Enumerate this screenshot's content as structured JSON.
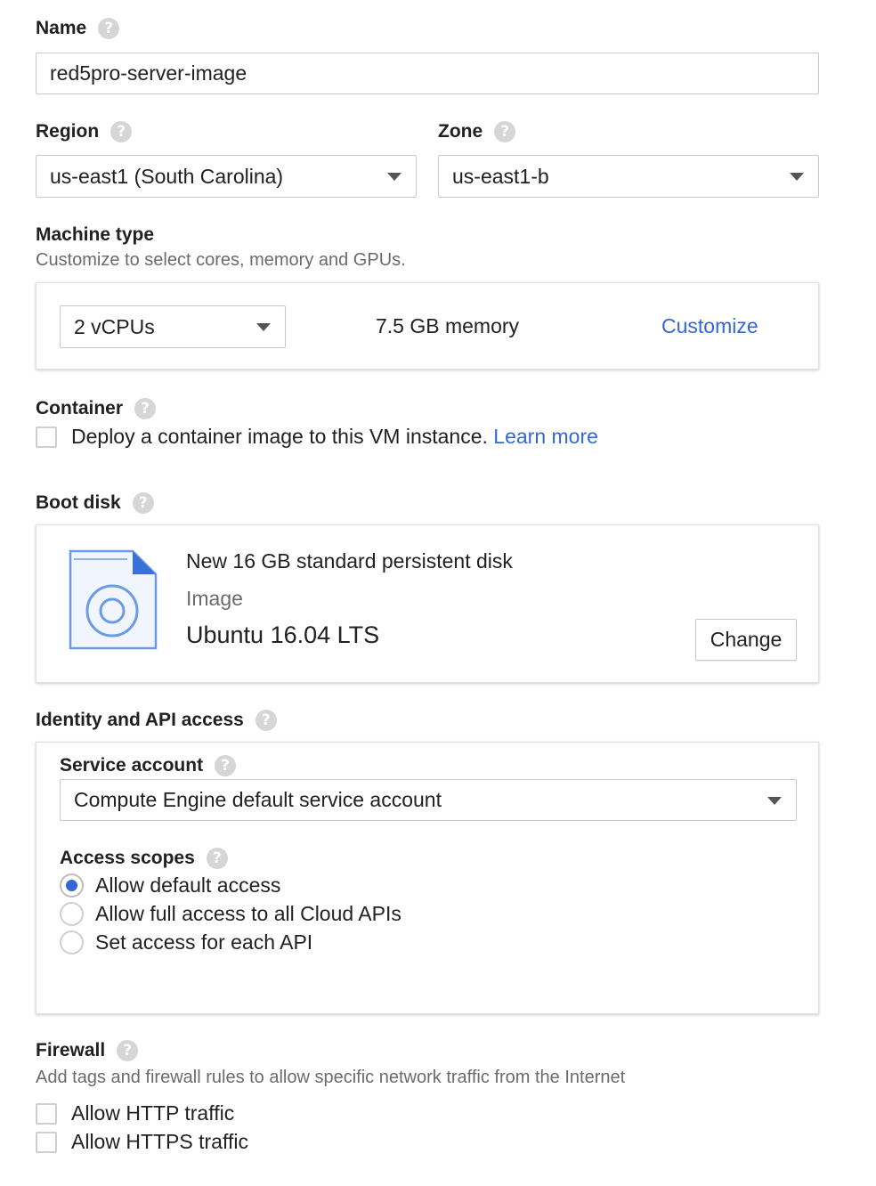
{
  "name": {
    "label": "Name",
    "value": "red5pro-server-image"
  },
  "region": {
    "label": "Region",
    "value": "us-east1 (South Carolina)"
  },
  "zone": {
    "label": "Zone",
    "value": "us-east1-b"
  },
  "machine_type": {
    "label": "Machine type",
    "description": "Customize to select cores, memory and GPUs.",
    "cpus": "2 vCPUs",
    "memory": "7.5 GB memory",
    "customize_label": "Customize"
  },
  "container": {
    "label": "Container",
    "checkbox_label": "Deploy a container image to this VM instance.",
    "learn_more": "Learn more"
  },
  "boot_disk": {
    "label": "Boot disk",
    "title": "New 16 GB standard persistent disk",
    "image_label": "Image",
    "image_value": "Ubuntu 16.04 LTS",
    "change_label": "Change"
  },
  "identity": {
    "label": "Identity and API access",
    "service_account_label": "Service account",
    "service_account_value": "Compute Engine default service account",
    "access_scopes_label": "Access scopes",
    "scopes": [
      {
        "label": "Allow default access",
        "selected": true
      },
      {
        "label": "Allow full access to all Cloud APIs",
        "selected": false
      },
      {
        "label": "Set access for each API",
        "selected": false
      }
    ]
  },
  "firewall": {
    "label": "Firewall",
    "description": "Add tags and firewall rules to allow specific network traffic from the Internet",
    "options": [
      "Allow HTTP traffic",
      "Allow HTTPS traffic"
    ]
  },
  "help_glyph": "?",
  "colors": {
    "accent": "#3367d6",
    "help": "#d6d6d6",
    "border": "#c8c8c8"
  }
}
